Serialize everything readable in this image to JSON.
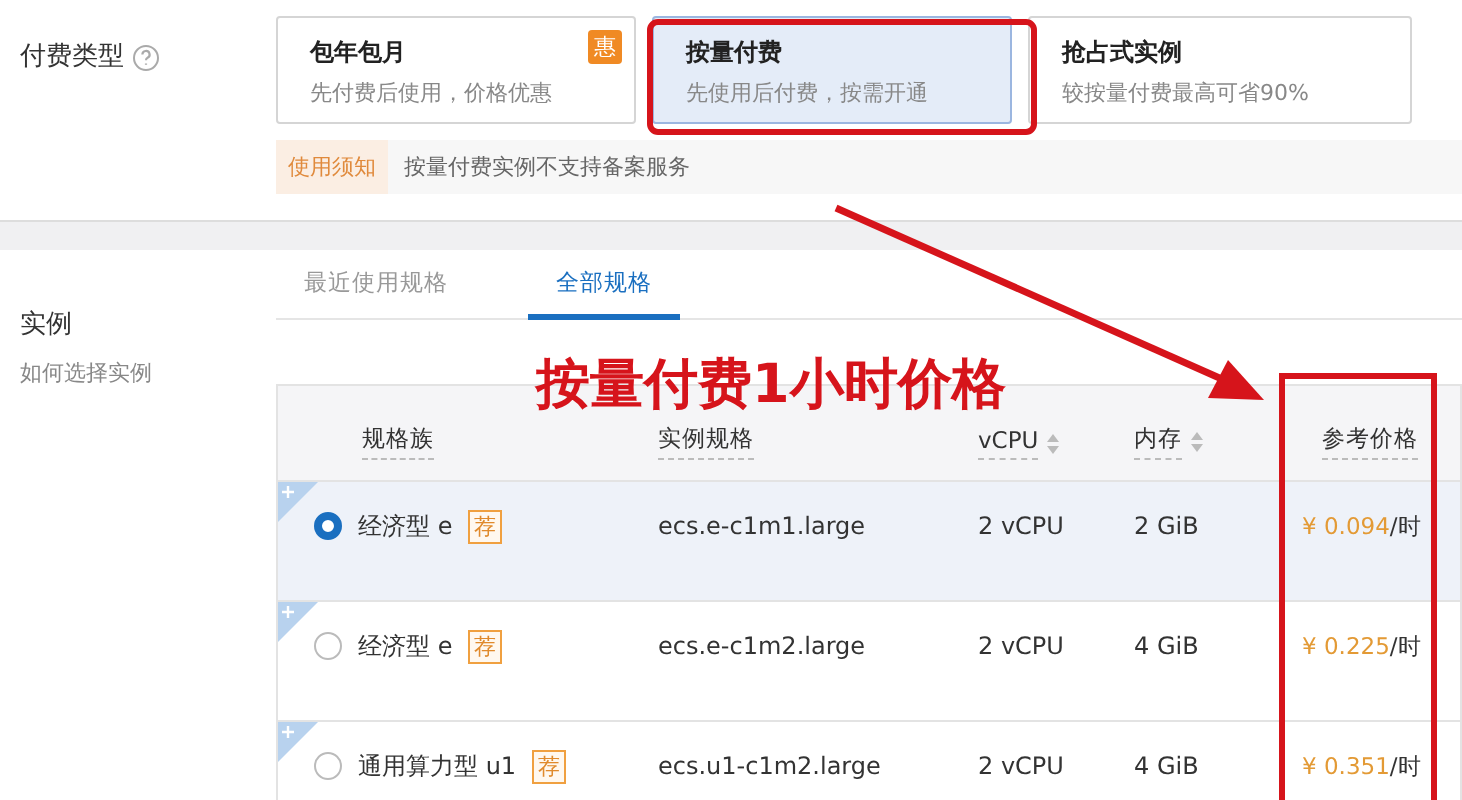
{
  "billing": {
    "label": "付费类型",
    "options": [
      {
        "title": "包年包月",
        "desc": "先付费后使用，价格优惠",
        "badge": "惠",
        "selected": false
      },
      {
        "title": "按量付费",
        "desc": "先使用后付费，按需开通",
        "selected": true
      },
      {
        "title": "抢占式实例",
        "desc": "较按量付费最高可省90%",
        "selected": false
      }
    ],
    "notice": {
      "tag": "使用须知",
      "text": "按量付费实例不支持备案服务"
    }
  },
  "instance": {
    "label": "实例",
    "link": "如何选择实例",
    "tabs": [
      {
        "label": "最近使用规格",
        "selected": false
      },
      {
        "label": "全部规格",
        "selected": true
      }
    ],
    "columns": [
      {
        "label": "规格族",
        "sortable": false
      },
      {
        "label": "实例规格",
        "sortable": false
      },
      {
        "label": "vCPU",
        "sortable": true
      },
      {
        "label": "内存",
        "sortable": true
      },
      {
        "label": "参考价格",
        "sortable": false
      }
    ],
    "rows": [
      {
        "family": "经济型 e",
        "tag": "荐",
        "spec": "ecs.e-c1m1.large",
        "vcpu": "2 vCPU",
        "memory": "2 GiB",
        "price": "¥ 0.094",
        "unit": "/时",
        "selected": true
      },
      {
        "family": "经济型 e",
        "tag": "荐",
        "spec": "ecs.e-c1m2.large",
        "vcpu": "2 vCPU",
        "memory": "4 GiB",
        "price": "¥ 0.225",
        "unit": "/时",
        "selected": false
      },
      {
        "family": "通用算力型 u1",
        "tag": "荐",
        "spec": "ecs.u1-c1m2.large",
        "vcpu": "2 vCPU",
        "memory": "4 GiB",
        "price": "¥ 0.351",
        "unit": "/时",
        "selected": false
      }
    ]
  },
  "annotation": {
    "text": "按量付费1小时价格"
  }
}
